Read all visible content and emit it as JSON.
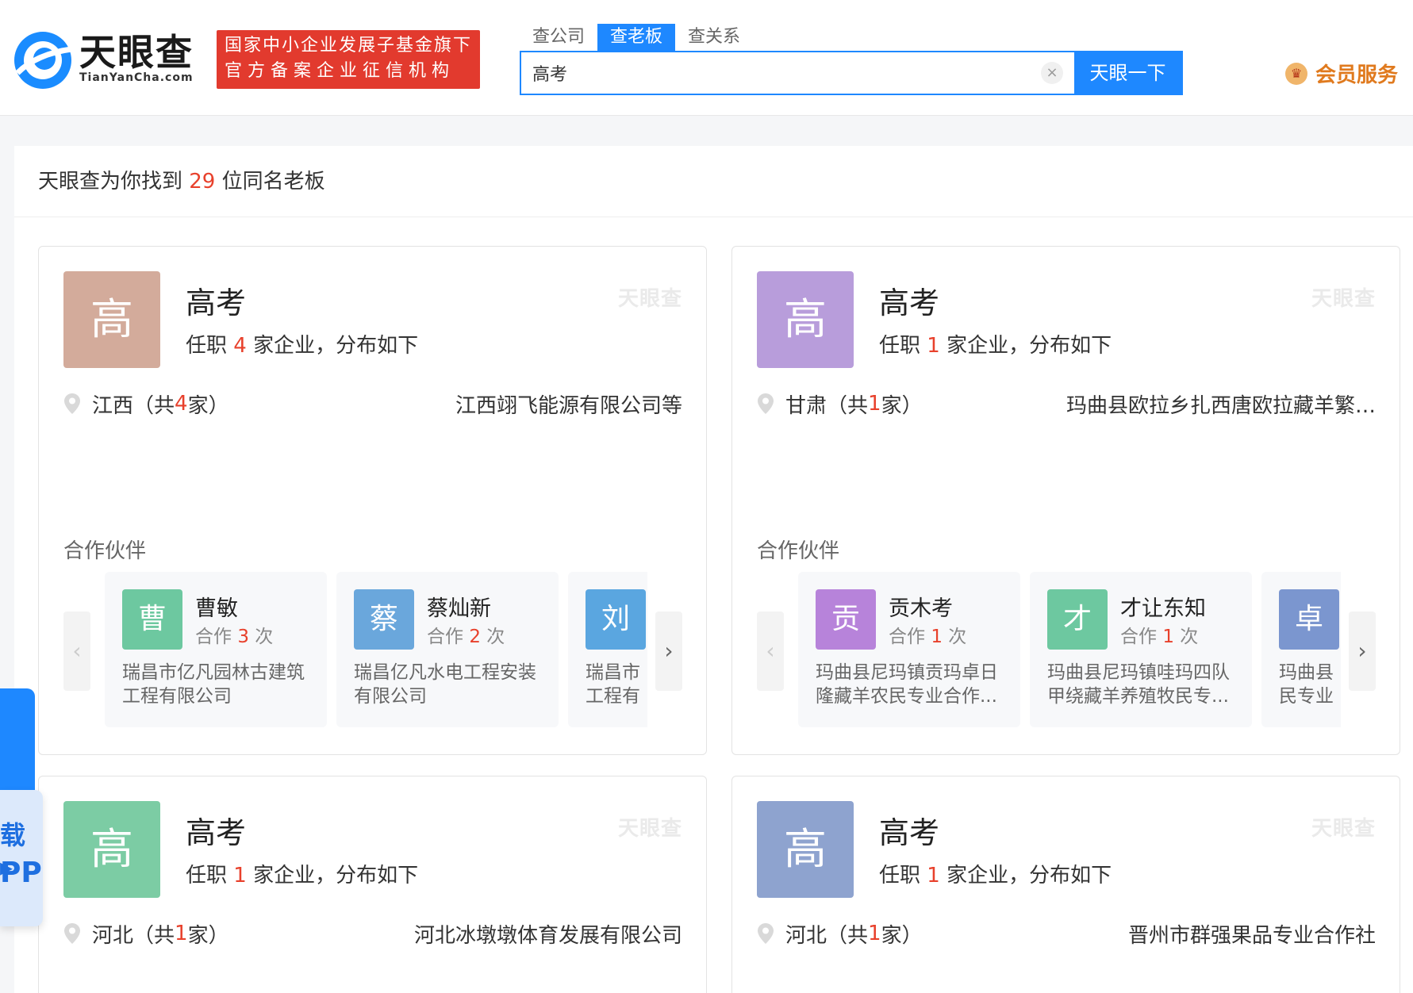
{
  "header": {
    "logo_text": "天眼查",
    "logo_sub": "TianYanCha.com",
    "slogan_line1": "国家中小企业发展子基金旗下",
    "slogan_line2": "官方备案企业征信机构",
    "tabs": [
      {
        "label": "查公司",
        "active": false
      },
      {
        "label": "查老板",
        "active": true
      },
      {
        "label": "查关系",
        "active": false
      }
    ],
    "search_value": "高考",
    "clear_symbol": "×",
    "search_button": "天眼一下",
    "vip_label": "会员服务"
  },
  "result": {
    "prefix": "天眼查为你找到 ",
    "count": "29",
    "suffix": " 位同名老板"
  },
  "cards": [
    {
      "avatar_char": "高",
      "avatar_color": "#d3ab9b",
      "name": "高考",
      "summary_prefix": "任职 ",
      "company_count": "4",
      "summary_suffix": " 家企业，分布如下",
      "watermark": "天眼查",
      "region_name": "江西（共",
      "region_count": "4",
      "region_suffix": "家）",
      "region_company": "江西翊飞能源有限公司等",
      "partners_title": "合作伙伴",
      "partners": [
        {
          "char": "曹",
          "color": "#6dc8a0",
          "name": "曹敏",
          "times_prefix": "合作 ",
          "times": "3",
          "times_suffix": " 次",
          "company": "瑞昌市亿凡园林古建筑工程有限公司"
        },
        {
          "char": "蔡",
          "color": "#6aa7dc",
          "name": "蔡灿新",
          "times_prefix": "合作 ",
          "times": "2",
          "times_suffix": " 次",
          "company": "瑞昌亿凡水电工程安装有限公司"
        },
        {
          "char": "刘",
          "color": "#5aa6e0",
          "name": "",
          "times_prefix": "",
          "times": "",
          "times_suffix": "",
          "company": "瑞昌市工程有"
        }
      ]
    },
    {
      "avatar_char": "高",
      "avatar_color": "#b89ddb",
      "name": "高考",
      "summary_prefix": "任职 ",
      "company_count": "1",
      "summary_suffix": " 家企业，分布如下",
      "watermark": "天眼查",
      "region_name": "甘肃（共",
      "region_count": "1",
      "region_suffix": "家）",
      "region_company": "玛曲县欧拉乡扎西唐欧拉藏羊繁…",
      "partners_title": "合作伙伴",
      "partners": [
        {
          "char": "贡",
          "color": "#b783da",
          "name": "贡木考",
          "times_prefix": "合作 ",
          "times": "1",
          "times_suffix": " 次",
          "company": "玛曲县尼玛镇贡玛卓日隆藏羊农民专业合作..."
        },
        {
          "char": "才",
          "color": "#6dc8a0",
          "name": "才让东知",
          "times_prefix": "合作 ",
          "times": "1",
          "times_suffix": " 次",
          "company": "玛曲县尼玛镇哇玛四队甲绕藏羊养殖牧民专..."
        },
        {
          "char": "卓",
          "color": "#7b96cf",
          "name": "",
          "times_prefix": "",
          "times": "",
          "times_suffix": "",
          "company": "玛曲县民专业"
        }
      ]
    },
    {
      "avatar_char": "高",
      "avatar_color": "#7ccca4",
      "name": "高考",
      "summary_prefix": "任职 ",
      "company_count": "1",
      "summary_suffix": " 家企业，分布如下",
      "watermark": "天眼查",
      "region_name": "河北（共",
      "region_count": "1",
      "region_suffix": "家）",
      "region_company": "河北冰墩墩体育发展有限公司"
    },
    {
      "avatar_char": "高",
      "avatar_color": "#8ea3cf",
      "name": "高考",
      "summary_prefix": "任职 ",
      "company_count": "1",
      "summary_suffix": " 家企业，分布如下",
      "watermark": "天眼查",
      "region_name": "河北（共",
      "region_count": "1",
      "region_suffix": "家）",
      "region_company": "晋州市群强果品专业合作社"
    }
  ],
  "app_tab": {
    "line1": "载▸",
    "line2": "PP"
  },
  "icons": {
    "pin": "location-pin-icon",
    "arrow_left": "‹",
    "arrow_right": "›",
    "vip": "crown-icon"
  }
}
